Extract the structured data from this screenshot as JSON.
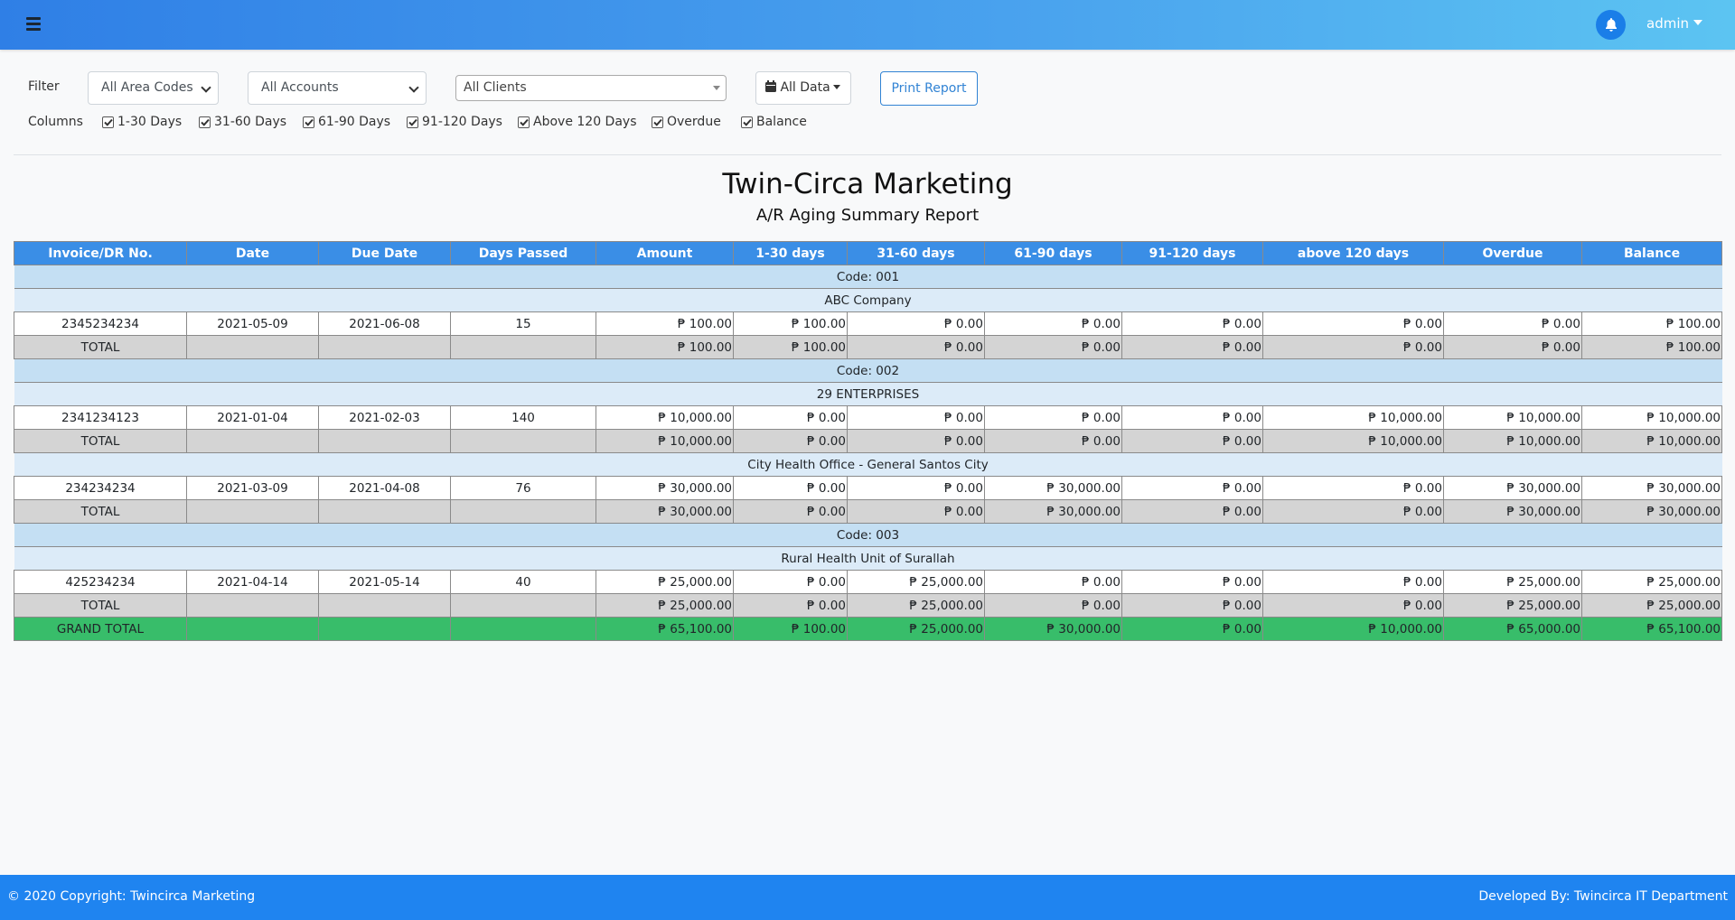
{
  "navbar": {
    "user": "admin"
  },
  "filters": {
    "label": "Filter",
    "area_codes": "All Area Codes",
    "accounts": "All Accounts",
    "clients": "All Clients",
    "data_range": "All Data",
    "print_label": "Print Report"
  },
  "columns_toggle": {
    "label": "Columns",
    "items": [
      {
        "label": "1-30 Days",
        "checked": true
      },
      {
        "label": "31-60 Days",
        "checked": true
      },
      {
        "label": "61-90 Days",
        "checked": true
      },
      {
        "label": "91-120 Days",
        "checked": true
      },
      {
        "label": "Above 120 Days",
        "checked": true
      },
      {
        "label": "Overdue",
        "checked": true
      },
      {
        "label": "Balance",
        "checked": true
      }
    ]
  },
  "report": {
    "company": "Twin-Circa Marketing",
    "title": "A/R Aging Summary Report",
    "headers": [
      "Invoice/DR No.",
      "Date",
      "Due Date",
      "Days Passed",
      "Amount",
      "1-30 days",
      "31-60 days",
      "61-90 days",
      "91-120 days",
      "above 120 days",
      "Overdue",
      "Balance"
    ],
    "rows": [
      {
        "type": "code",
        "text": "Code: 001"
      },
      {
        "type": "client",
        "text": "ABC Company"
      },
      {
        "type": "row",
        "cells": [
          "2345234234",
          "2021-05-09",
          "2021-06-08",
          "15",
          "₱ 100.00",
          "₱ 100.00",
          "₱ 0.00",
          "₱ 0.00",
          "₱ 0.00",
          "₱ 0.00",
          "₱ 0.00",
          "₱ 100.00"
        ]
      },
      {
        "type": "total",
        "cells": [
          "TOTAL",
          "",
          "",
          "",
          "₱ 100.00",
          "₱ 100.00",
          "₱ 0.00",
          "₱ 0.00",
          "₱ 0.00",
          "₱ 0.00",
          "₱ 0.00",
          "₱ 100.00"
        ]
      },
      {
        "type": "code",
        "text": "Code: 002"
      },
      {
        "type": "client",
        "text": "29 ENTERPRISES"
      },
      {
        "type": "row",
        "cells": [
          "2341234123",
          "2021-01-04",
          "2021-02-03",
          "140",
          "₱ 10,000.00",
          "₱ 0.00",
          "₱ 0.00",
          "₱ 0.00",
          "₱ 0.00",
          "₱ 10,000.00",
          "₱ 10,000.00",
          "₱ 10,000.00"
        ]
      },
      {
        "type": "total",
        "cells": [
          "TOTAL",
          "",
          "",
          "",
          "₱ 10,000.00",
          "₱ 0.00",
          "₱ 0.00",
          "₱ 0.00",
          "₱ 0.00",
          "₱ 10,000.00",
          "₱ 10,000.00",
          "₱ 10,000.00"
        ]
      },
      {
        "type": "client",
        "text": "City Health Office - General Santos City"
      },
      {
        "type": "row",
        "cells": [
          "234234234",
          "2021-03-09",
          "2021-04-08",
          "76",
          "₱ 30,000.00",
          "₱ 0.00",
          "₱ 0.00",
          "₱ 30,000.00",
          "₱ 0.00",
          "₱ 0.00",
          "₱ 30,000.00",
          "₱ 30,000.00"
        ]
      },
      {
        "type": "total",
        "cells": [
          "TOTAL",
          "",
          "",
          "",
          "₱ 30,000.00",
          "₱ 0.00",
          "₱ 0.00",
          "₱ 30,000.00",
          "₱ 0.00",
          "₱ 0.00",
          "₱ 30,000.00",
          "₱ 30,000.00"
        ]
      },
      {
        "type": "code",
        "text": "Code: 003"
      },
      {
        "type": "client",
        "text": "Rural Health Unit of Surallah"
      },
      {
        "type": "row",
        "cells": [
          "425234234",
          "2021-04-14",
          "2021-05-14",
          "40",
          "₱ 25,000.00",
          "₱ 0.00",
          "₱ 25,000.00",
          "₱ 0.00",
          "₱ 0.00",
          "₱ 0.00",
          "₱ 25,000.00",
          "₱ 25,000.00"
        ]
      },
      {
        "type": "total",
        "cells": [
          "TOTAL",
          "",
          "",
          "",
          "₱ 25,000.00",
          "₱ 0.00",
          "₱ 25,000.00",
          "₱ 0.00",
          "₱ 0.00",
          "₱ 0.00",
          "₱ 25,000.00",
          "₱ 25,000.00"
        ]
      },
      {
        "type": "grand",
        "cells": [
          "GRAND TOTAL",
          "",
          "",
          "",
          "₱ 65,100.00",
          "₱ 100.00",
          "₱ 25,000.00",
          "₱ 30,000.00",
          "₱ 0.00",
          "₱ 10,000.00",
          "₱ 65,000.00",
          "₱ 65,100.00"
        ]
      }
    ]
  },
  "footer": {
    "copyright": "© 2020 Copyright: Twincirca Marketing",
    "developer": "Developed By: Twincirca IT Department"
  },
  "colors": {
    "header": "#3a8ee6",
    "grand_total": "#38bd6a",
    "footer": "#1f84f0"
  }
}
